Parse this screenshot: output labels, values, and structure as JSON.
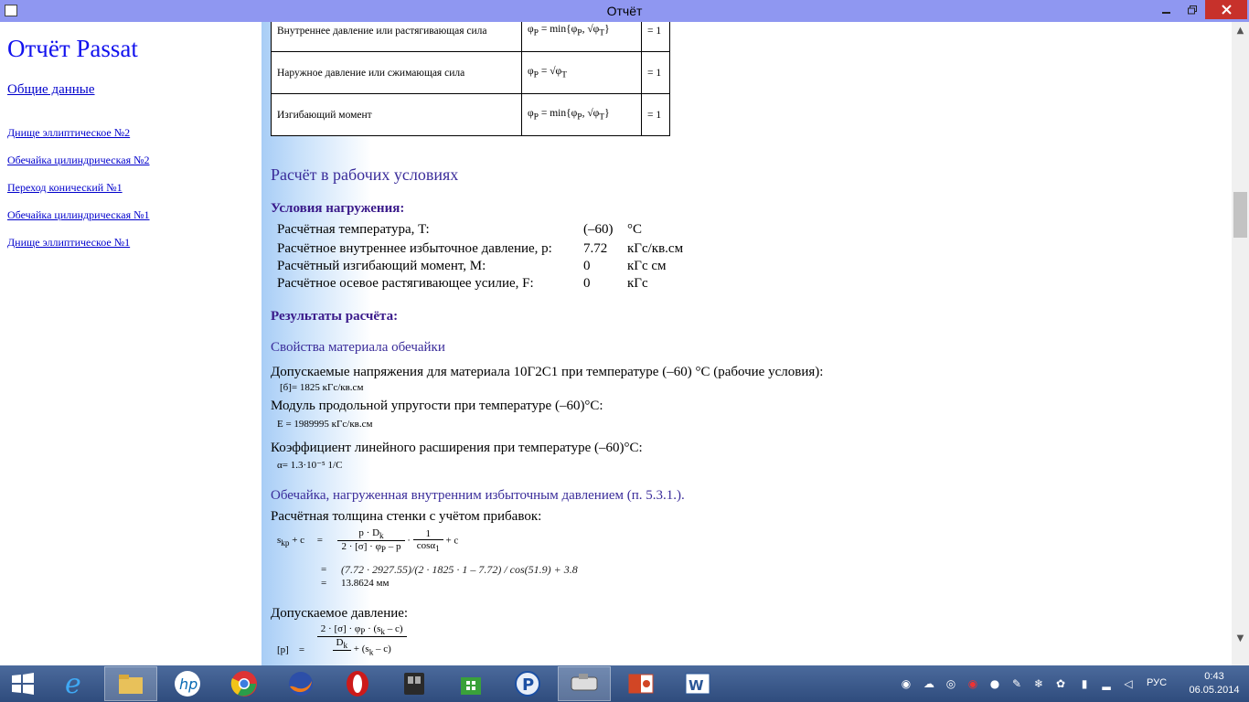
{
  "window": {
    "title": "Отчёт"
  },
  "nav": {
    "title": "Отчёт Passat",
    "general": "Общие данные",
    "items": [
      "Днище эллиптическое №2",
      "Обечайка цилиндрическая №2",
      "Переход конический №1",
      "Обечайка цилиндрическая №1",
      "Днище эллиптическое №1"
    ]
  },
  "coef_table": {
    "rows": [
      {
        "label": "Внутреннее давление или растягивающая сила",
        "value": "= 1"
      },
      {
        "label": "Наружное давление или сжимающая сила",
        "value": "= 1"
      },
      {
        "label": "Изгибающий момент",
        "value": "= 1"
      }
    ]
  },
  "work": {
    "title": "Расчёт в рабочих условиях",
    "loads_title": "Условия нагружения:",
    "loads": [
      {
        "label": "Расчётная температура, T:",
        "value": "(–60)",
        "unit": "°C"
      },
      {
        "label": "Расчётное внутреннее избыточное давление, p:",
        "value": "7.72",
        "unit": "кГс/кв.см"
      },
      {
        "label": "Расчётный изгибающий момент, M:",
        "value": "0",
        "unit": "кГс см"
      },
      {
        "label": "Расчётное осевое растягивающее усилие, F:",
        "value": "0",
        "unit": "кГс"
      }
    ],
    "results_title": "Результаты расчёта:",
    "material_title": "Свойства материала обечайки",
    "allow_text": "Допускаемые напряжения для материала 10Г2С1 при температуре (–60) °C (рабочие условия):",
    "allow_value": "[б]=    1825 кГс/кв.см",
    "modulus_text": "Модуль продольной упругости при температуре (–60)°C:",
    "modulus_value": "E =     1989995 кГс/кв.см",
    "expansion_text": "Коэффициент линейного расширения при температуре (–60)°C:",
    "expansion_value": "α=     1.3·10⁻⁵ 1/C",
    "shell_title": "Обечайка, нагруженная внутренним избыточным давлением (п. 5.3.1.).",
    "thickness_text": "Расчётная толщина стенки с учётом прибавок:",
    "thickness_subst": "(7.72 · 2927.55)/(2 · 1825 · 1 – 7.72) / cos(51.9) + 3.8",
    "thickness_result": "13.8624 мм",
    "pressure_text": "Допускаемое давление:"
  },
  "taskbar": {
    "time": "0:43",
    "date": "06.05.2014",
    "lang": "РУС"
  }
}
